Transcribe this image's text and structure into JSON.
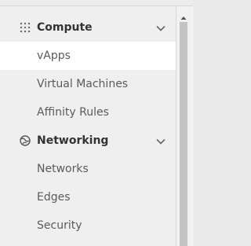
{
  "sidebar": {
    "sections": [
      {
        "label": "Compute",
        "icon": "grid-dots-icon",
        "items": [
          {
            "label": "vApps",
            "active": true
          },
          {
            "label": "Virtual Machines",
            "active": false
          },
          {
            "label": "Affinity Rules",
            "active": false
          }
        ]
      },
      {
        "label": "Networking",
        "icon": "globe-network-icon",
        "items": [
          {
            "label": "Networks",
            "active": false
          },
          {
            "label": "Edges",
            "active": false
          },
          {
            "label": "Security",
            "active": false
          }
        ]
      }
    ]
  },
  "colors": {
    "sidebar_bg": "#efefef",
    "active_bg": "#ffffff",
    "header_text": "#333333",
    "item_text": "#5b5b5b",
    "scrollbar_thumb": "#c3c3c3"
  }
}
